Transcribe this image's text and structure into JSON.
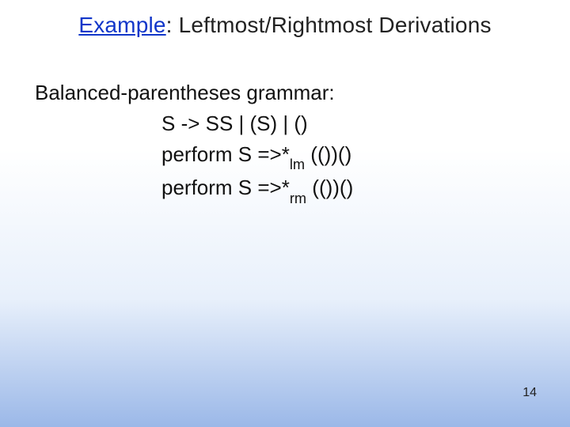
{
  "title": {
    "accent": "Example",
    "rest": ": Leftmost/Rightmost Derivations"
  },
  "body": {
    "line1": "Balanced-parentheses grammar:",
    "line2": "S -> SS | (S) | ()",
    "line3_prefix": "perform S =>*",
    "line3_sub": "lm",
    "line3_suffix": " (())()",
    "line4_prefix": "perform S =>*",
    "line4_sub": "rm",
    "line4_suffix": " (())()"
  },
  "page": "14"
}
